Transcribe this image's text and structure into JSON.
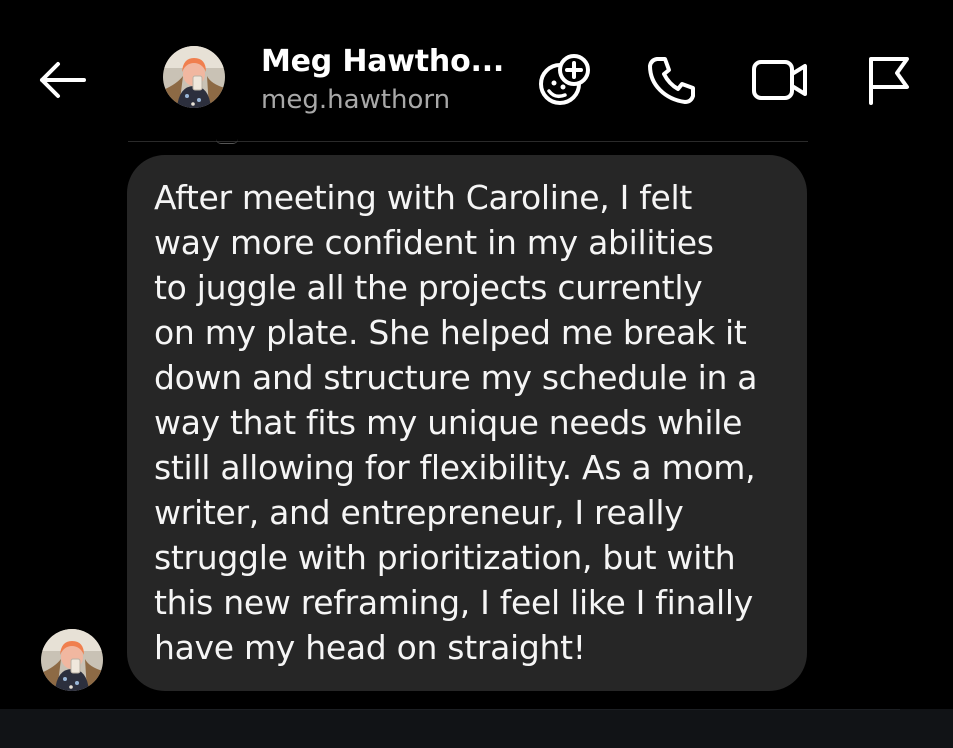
{
  "header": {
    "contact_name": "Meg Hawtho...",
    "contact_handle": "meg.hawthorn",
    "icons": {
      "back": "arrow-left-icon",
      "effects": "sticker-add-icon",
      "call": "phone-icon",
      "video": "video-camera-icon",
      "flag": "flag-icon"
    }
  },
  "conversation": {
    "messages": [
      {
        "text": "After meeting with Caroline, I felt\nway more confident in my abilities\nto juggle all the projects currently\non my plate. She helped me break it\ndown and structure my schedule in a\nway that fits my unique needs while\nstill allowing for flexibility. As a mom,\nwriter, and entrepreneur, I really\nstruggle with prioritization, but with\nthis new reframing, I feel like I finally\nhave my head on straight!"
      }
    ]
  },
  "colors": {
    "background": "#000000",
    "bubble": "#262626",
    "handle_text": "#a8a8a8",
    "composer_bar": "#111316"
  }
}
